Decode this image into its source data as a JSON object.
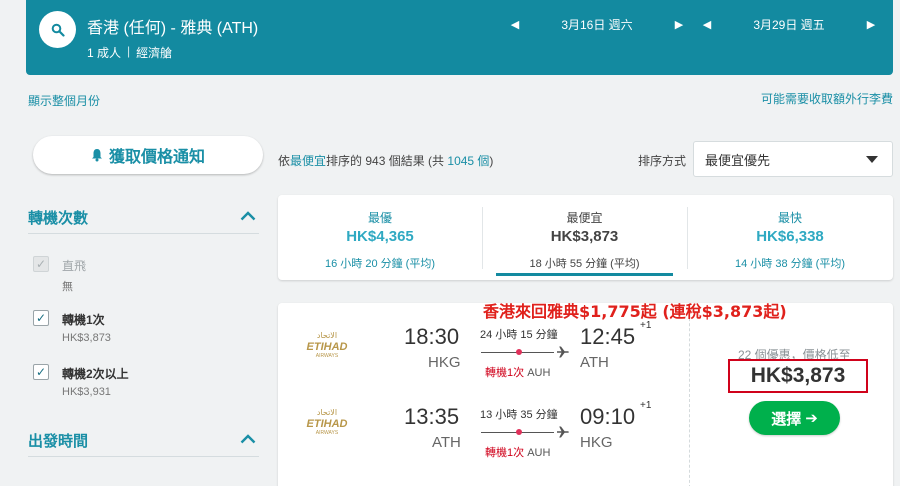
{
  "header": {
    "route": "香港 (任何) - 雅典 (ATH)",
    "passengers": "1 成人",
    "cabin": "經濟艙",
    "depart_date": "3月16日 週六",
    "return_date": "3月29日 週五"
  },
  "links": {
    "show_month": "顯示整個月份",
    "extra_fees": "可能需要收取額外行李費"
  },
  "notify_button": "獲取價格通知",
  "stops_filter": {
    "title": "轉機次數",
    "options": [
      {
        "label": "直飛",
        "price": "無",
        "checked": true,
        "disabled": true
      },
      {
        "label": "轉機1次",
        "price": "HK$3,873",
        "checked": true,
        "disabled": false
      },
      {
        "label": "轉機2次以上",
        "price": "HK$3,931",
        "checked": true,
        "disabled": false
      }
    ]
  },
  "departure_filter": {
    "title": "出發時間"
  },
  "sort_info": {
    "prefix": "依",
    "highlight": "最便宜",
    "middle": "排序的 943 個結果 (共 ",
    "total": "1045 個",
    "suffix": ")"
  },
  "sort": {
    "label": "排序方式",
    "selected": "最便宜優先"
  },
  "summary_tabs": [
    {
      "title": "最優",
      "price": "HK$4,365",
      "duration": "16 小時 20 分鐘 (平均)",
      "active": false
    },
    {
      "title": "最便宜",
      "price": "HK$3,873",
      "duration": "18 小時 55 分鐘 (平均)",
      "active": true
    },
    {
      "title": "最快",
      "price": "HK$6,338",
      "duration": "14 小時 38 分鐘 (平均)",
      "active": false
    }
  ],
  "promo_text": "香港來回雅典$1,775起 (連稅$3,873起)",
  "result": {
    "airline": "ETIHAD",
    "airline_sub": "AIRWAYS",
    "airline_arabic": "الاتحاد",
    "legs": [
      {
        "depart_time": "18:30",
        "depart_code": "HKG",
        "arrive_time": "12:45",
        "arrive_code": "ATH",
        "plus_day": "+1",
        "duration": "24 小時 15 分鐘",
        "stops": "轉機1次",
        "via": "AUH"
      },
      {
        "depart_time": "13:35",
        "depart_code": "ATH",
        "arrive_time": "09:10",
        "arrive_code": "HKG",
        "plus_day": "+1",
        "duration": "13 小時 35 分鐘",
        "stops": "轉機1次",
        "via": "AUH"
      }
    ],
    "deals": "22 個優惠，價格低至",
    "price": "HK$3,873",
    "select_label": "選擇",
    "select_arrow": "➔"
  },
  "colors": {
    "teal": "#138aa0",
    "link": "#1a8fa6",
    "green": "#00b04c",
    "red": "#d0021b",
    "etihad_gold": "#b8974a"
  }
}
